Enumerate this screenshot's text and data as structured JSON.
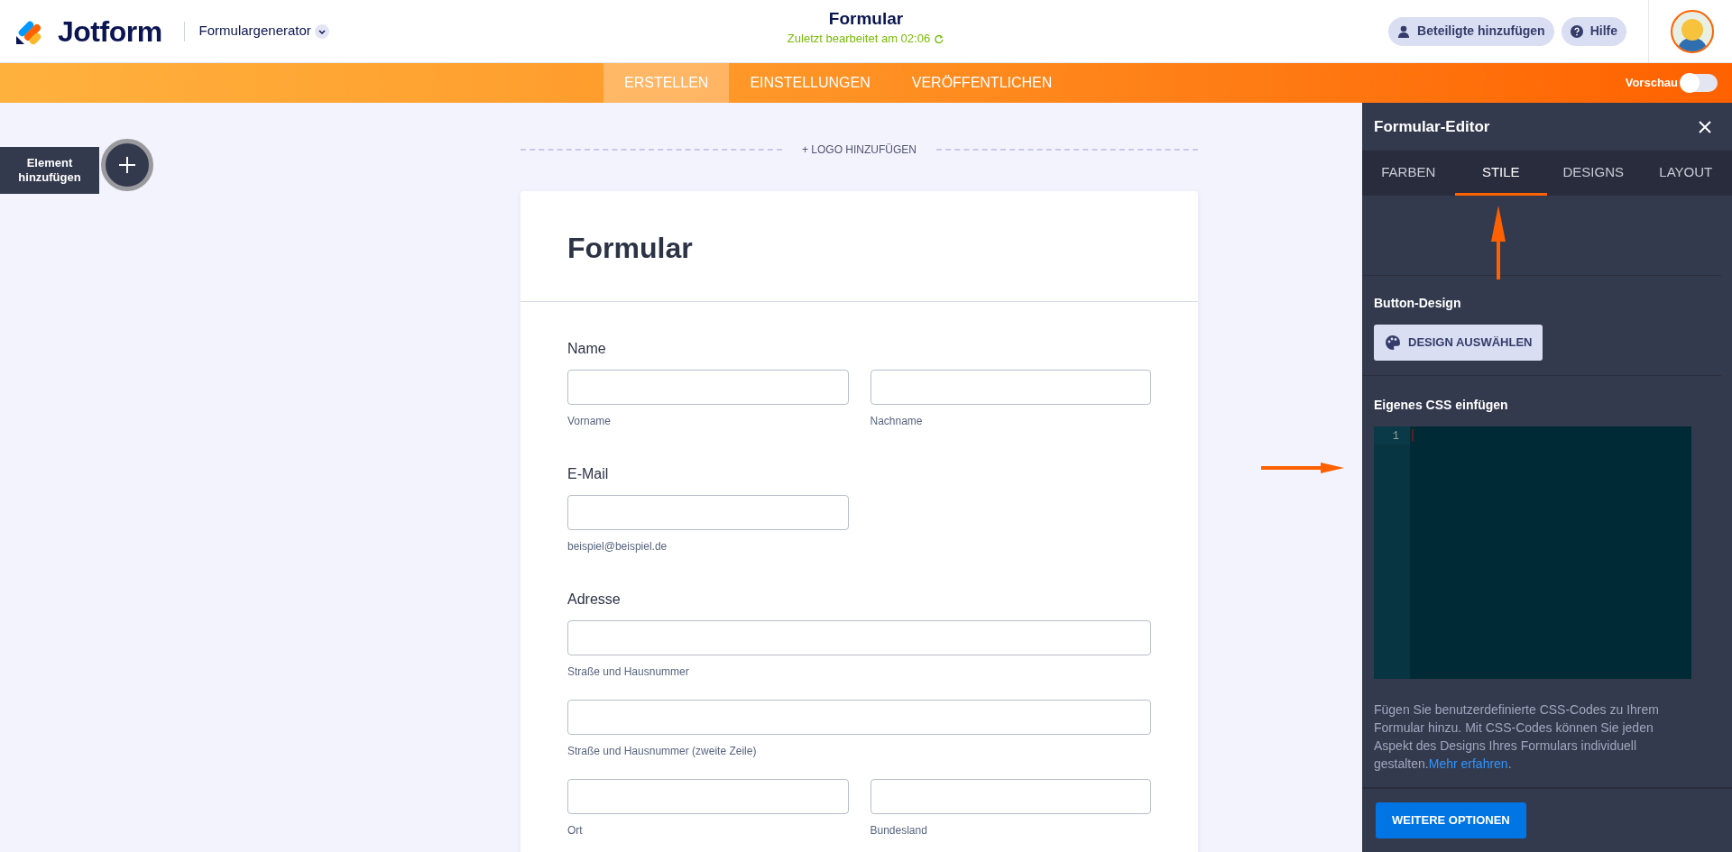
{
  "header": {
    "brand": "Jotform",
    "app_menu": "Formulargenerator",
    "title": "Formular",
    "saved": "Zuletzt bearbeitet am 02:06",
    "buttons": [
      {
        "kind": "person",
        "label": "Beteiligte hinzufügen"
      },
      {
        "kind": "help",
        "label": "Hilfe"
      }
    ]
  },
  "nav": {
    "tabs": [
      {
        "label": "ERSTELLEN",
        "selected": true
      },
      {
        "label": "EINSTELLUNGEN",
        "selected": false
      },
      {
        "label": "VERÖFFENTLICHEN",
        "selected": false
      }
    ],
    "preview": {
      "label": "Vorschau",
      "on": false
    }
  },
  "add_element": "Element hinzufügen",
  "logo_link": "+ LOGO HINZUFÜGEN",
  "form": {
    "title": "Formular",
    "questions": [
      {
        "label": "Name",
        "rows": [
          {
            "kind": "pair",
            "inputs": [
              {
                "sublabel": "Vorname"
              },
              {
                "sublabel": "Nachname"
              }
            ]
          }
        ]
      },
      {
        "label": "E-Mail",
        "rows": [
          {
            "kind": "half",
            "inputs": [
              {
                "sublabel": "beispiel@beispiel.de"
              }
            ]
          }
        ]
      },
      {
        "label": "Adresse",
        "rows": [
          {
            "kind": "full",
            "inputs": [
              {
                "sublabel": "Straße und Hausnummer"
              }
            ]
          },
          {
            "kind": "full",
            "inputs": [
              {
                "sublabel": "Straße und Hausnummer (zweite Zeile)"
              }
            ]
          },
          {
            "kind": "pair",
            "inputs": [
              {
                "sublabel": "Ort"
              },
              {
                "sublabel": "Bundesland"
              }
            ]
          }
        ]
      }
    ]
  },
  "panel": {
    "title": "Formular-Editor",
    "tabs": [
      {
        "label": "FARBEN",
        "selected": false
      },
      {
        "label": "STILE",
        "selected": true
      },
      {
        "label": "DESIGNS",
        "selected": false
      },
      {
        "label": "LAYOUT",
        "selected": false
      }
    ],
    "button_design": {
      "title": "Button-Design",
      "button": "DESIGN AUSWÄHLEN"
    },
    "custom_css": {
      "title": "Eigenes CSS einfügen",
      "line_numbers": [
        "1"
      ],
      "help": "Fügen Sie benutzerdefinierte CSS-Codes zu Ihrem Formular hinzu. Mit CSS-Codes können Sie jeden Aspekt des Designs Ihres Formulars individuell gestalten.",
      "link": "Mehr erfahren",
      "help_end": "."
    },
    "footer_button": "WEITERE OPTIONEN"
  }
}
